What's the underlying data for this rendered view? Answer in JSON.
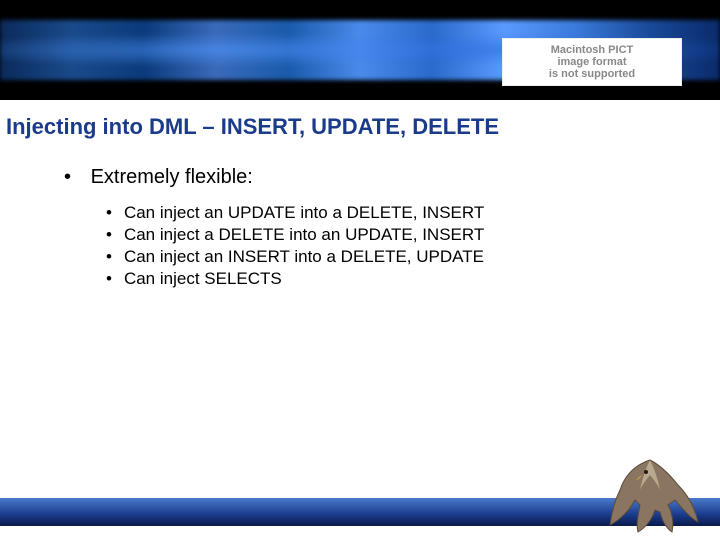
{
  "pict_box": {
    "line1": "Macintosh PICT",
    "line2": "image format",
    "line3": "is not supported"
  },
  "title": "Injecting into DML – INSERT, UPDATE, DELETE",
  "bullets": {
    "main": "Extremely flexible:",
    "sub": [
      "Can inject an UPDATE into a DELETE, INSERT",
      "Can inject a DELETE into an UPDATE, INSERT",
      "Can inject an INSERT into a DELETE, UPDATE",
      "Can inject SELECTS"
    ]
  }
}
